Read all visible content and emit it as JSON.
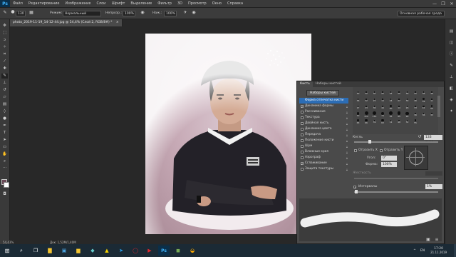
{
  "menubar": {
    "logo": "Ps",
    "items": [
      "Файл",
      "Редактирование",
      "Изображение",
      "Слои",
      "Шрифт",
      "Выделение",
      "Фильтр",
      "3D",
      "Просмотр",
      "Окно",
      "Справка"
    ],
    "window_controls": [
      "—",
      "❐",
      "✕"
    ]
  },
  "options": {
    "brush_size": "130",
    "mode_label": "Режим:",
    "mode_value": "Нормальный",
    "opacity_label": "Непрозр.:",
    "opacity_value": "100%",
    "pressure_label": "Наж.:",
    "pressure_value": "100%",
    "workspace": "Основная рабочая среда"
  },
  "document": {
    "tab_title": "photo_2019-11-19_14-12-44.jpg @ 54,4% (Слой 2, RGB/8#) *",
    "tab_close": "×"
  },
  "statusbar": {
    "zoom": "54,43%",
    "doc_info": "Док: 1,52М/1,40М"
  },
  "brush_panel": {
    "tabs": [
      "Кисть",
      "Наборы кистей"
    ],
    "presets_button": "Наборы кистей",
    "options": [
      {
        "label": "Форма отпечатка кисти",
        "checked": null,
        "selected": true
      },
      {
        "label": "Динамика формы",
        "checked": true,
        "selected": false
      },
      {
        "label": "Рассеивание",
        "checked": false,
        "selected": false
      },
      {
        "label": "Текстура",
        "checked": false,
        "selected": false
      },
      {
        "label": "Двойная кисть",
        "checked": false,
        "selected": false
      },
      {
        "label": "Динамика цвета",
        "checked": false,
        "selected": false
      },
      {
        "label": "Передача",
        "checked": false,
        "selected": false
      },
      {
        "label": "Положение кисти",
        "checked": false,
        "selected": false
      },
      {
        "label": "Шум",
        "checked": false,
        "selected": false
      },
      {
        "label": "Влажные края",
        "checked": false,
        "selected": false
      },
      {
        "label": "Аэрограф",
        "checked": false,
        "selected": false
      },
      {
        "label": "Сглаживание",
        "checked": true,
        "selected": false
      },
      {
        "label": "Защита текстуры",
        "checked": false,
        "selected": false
      }
    ],
    "tip_sizes": [
      "30",
      "30",
      "30",
      "25",
      "25",
      "25",
      "36",
      "25",
      "36",
      "36",
      "36",
      "32",
      "25",
      "14",
      "24",
      "27",
      "39",
      "46",
      "59",
      "11",
      "17",
      "23",
      "36",
      "44",
      "60",
      "14",
      "26",
      "33",
      "42",
      "55",
      "70",
      "112",
      "134",
      "74",
      "95",
      "95",
      "90",
      "36",
      "36",
      "33",
      "63",
      "66",
      "39",
      "63",
      "11",
      "48",
      "32",
      "55"
    ],
    "size_label": "Кегль",
    "size_value": "133 пикс.",
    "flip_x": "Отразить Х",
    "flip_y": "Отразить Y",
    "angle_label": "Угол:",
    "angle_value": "0°",
    "roundness_label": "Форма:",
    "roundness_value": "100%",
    "hardness_label": "Жесткость",
    "spacing_label": "Интервалы",
    "spacing_value": "1%",
    "spacing_checked": true
  },
  "taskbar": {
    "lang": "EN",
    "time": "17:20",
    "date": "21.11.2019"
  },
  "colors": {
    "app_bg": "#282828",
    "panel_bg": "#4a4a4a",
    "selection": "#2c6db5",
    "canvas_pink": "#c7aab6",
    "taskbar": "#1b2a35"
  }
}
